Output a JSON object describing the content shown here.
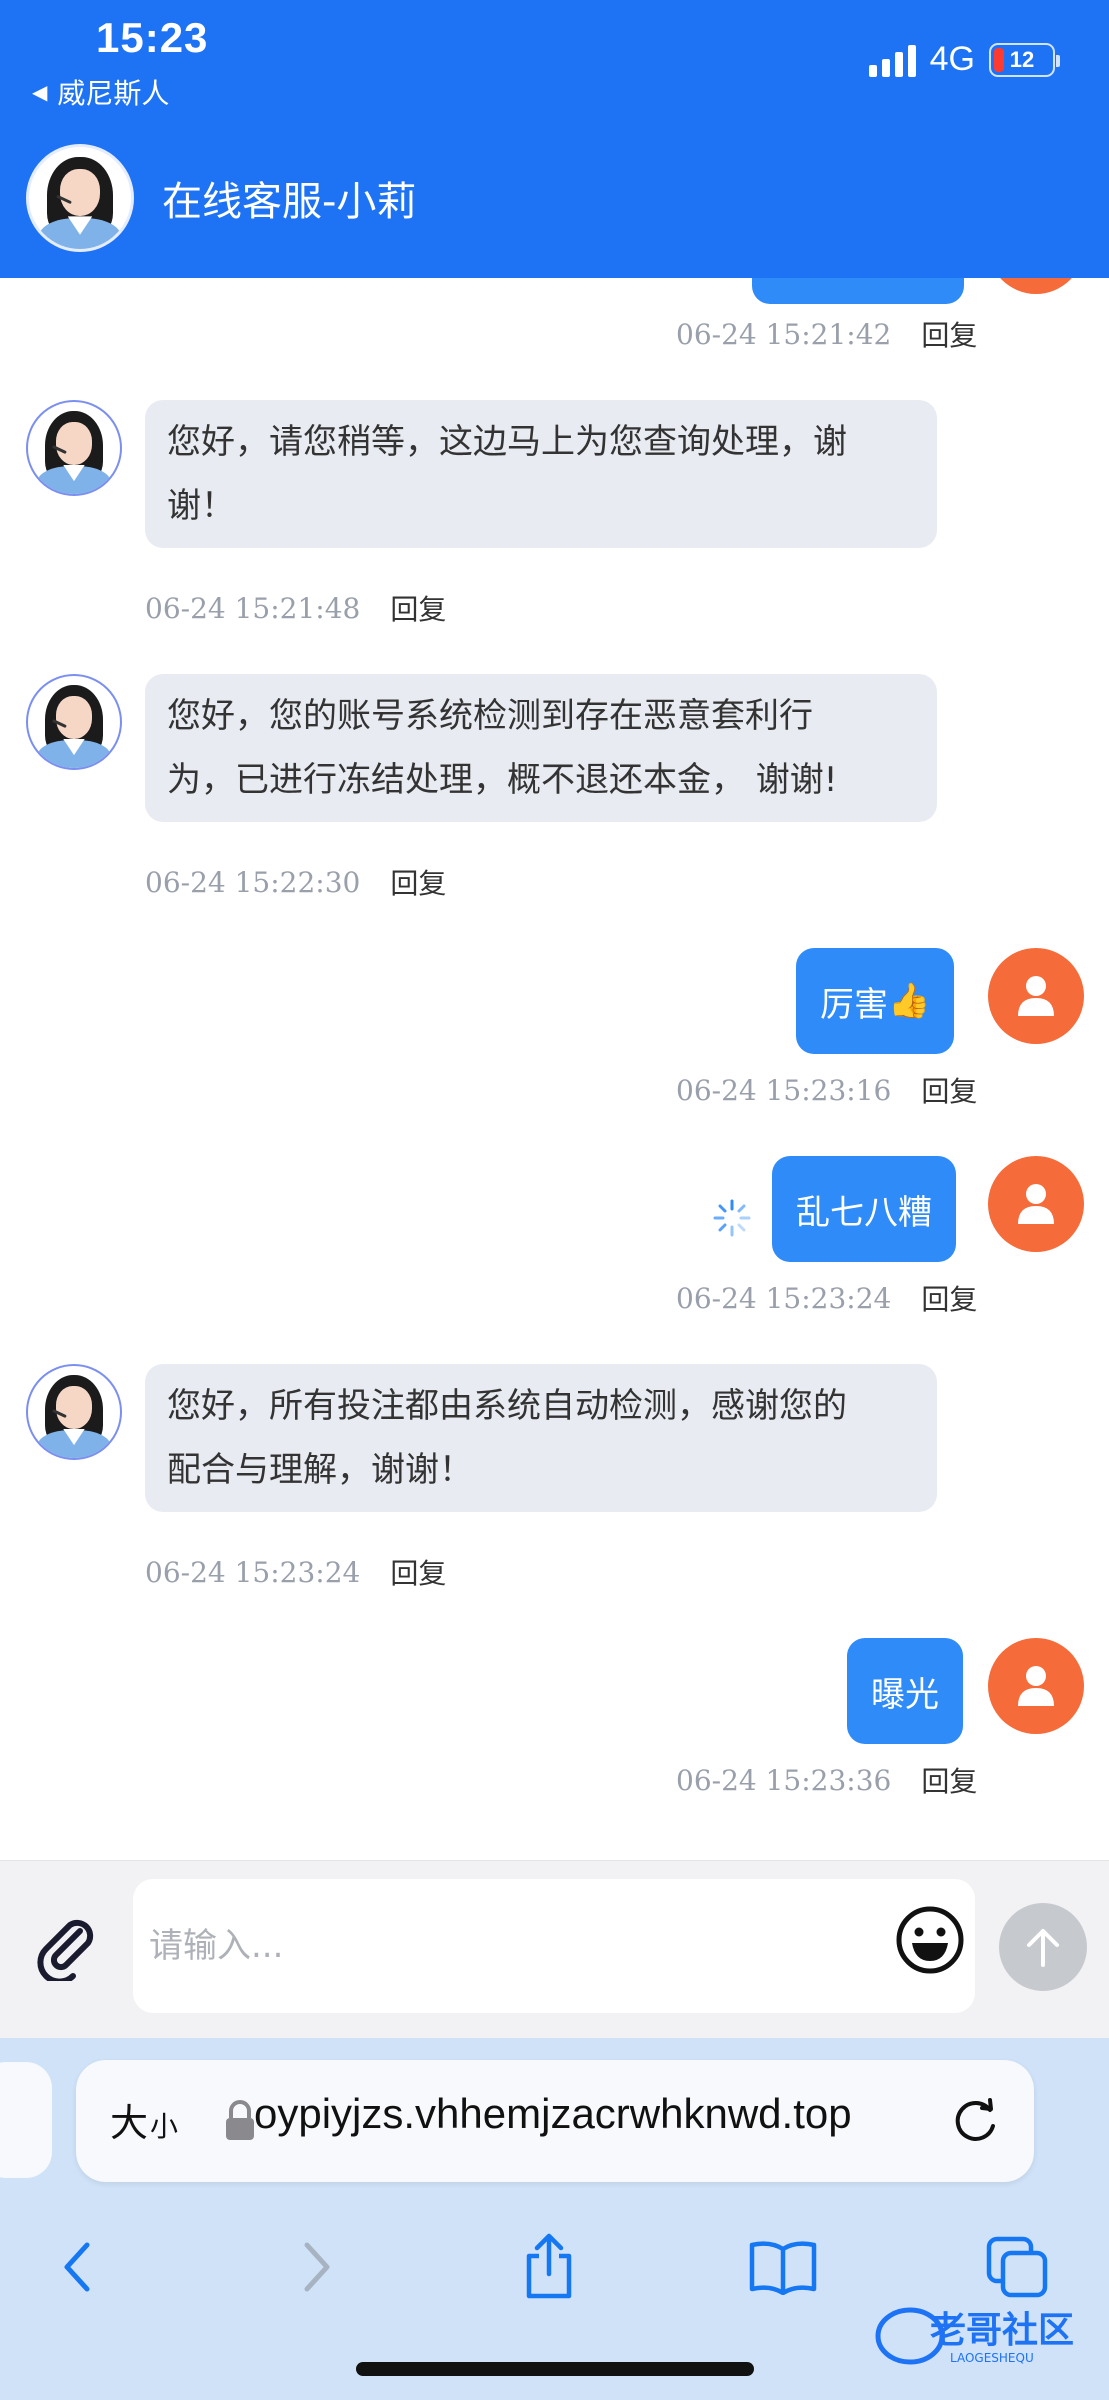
{
  "status_bar": {
    "time": "15:23",
    "back_app": "威尼斯人",
    "network": "4G",
    "battery": "12"
  },
  "header": {
    "title": "在线客服-小莉"
  },
  "messages": [
    {
      "side": "right",
      "text": "",
      "time": "06-24 15:21:42",
      "reply": "回复"
    },
    {
      "side": "left",
      "lines": [
        "您好，请您稍等，这边马上为您查询处理，谢",
        "谢！"
      ],
      "time": "06-24 15:21:48",
      "reply": "回复"
    },
    {
      "side": "left",
      "lines": [
        "您好，您的账号系统检测到存在恶意套利行",
        "为，已进行冻结处理，概不退还本金， 谢谢!"
      ],
      "time": "06-24 15:22:30",
      "reply": "回复"
    },
    {
      "side": "right",
      "text": "厉害",
      "emoji": "👍",
      "time": "06-24 15:23:16",
      "reply": "回复"
    },
    {
      "side": "right",
      "text": "乱七八糟",
      "time": "06-24 15:23:24",
      "reply": "回复"
    },
    {
      "side": "left",
      "lines": [
        "您好，所有投注都由系统自动检测，感谢您的",
        "配合与理解，谢谢！"
      ],
      "time": "06-24 15:23:24",
      "reply": "回复"
    },
    {
      "side": "right",
      "text": "曝光",
      "time": "06-24 15:23:36",
      "reply": "回复"
    }
  ],
  "input": {
    "placeholder": "请输入..."
  },
  "browser": {
    "text_size_big": "大",
    "text_size_small": "小",
    "url": "oypiyjzs.vhhemjzacrwhknwd.top"
  },
  "watermark": {
    "text": "老哥社区",
    "sub": "LAOGESHEQU"
  },
  "colors": {
    "header": "#1e73f5",
    "user_bubble": "#2e8bf7",
    "agent_bubble": "#e8ebf1",
    "user_avatar": "#f56c3a"
  }
}
